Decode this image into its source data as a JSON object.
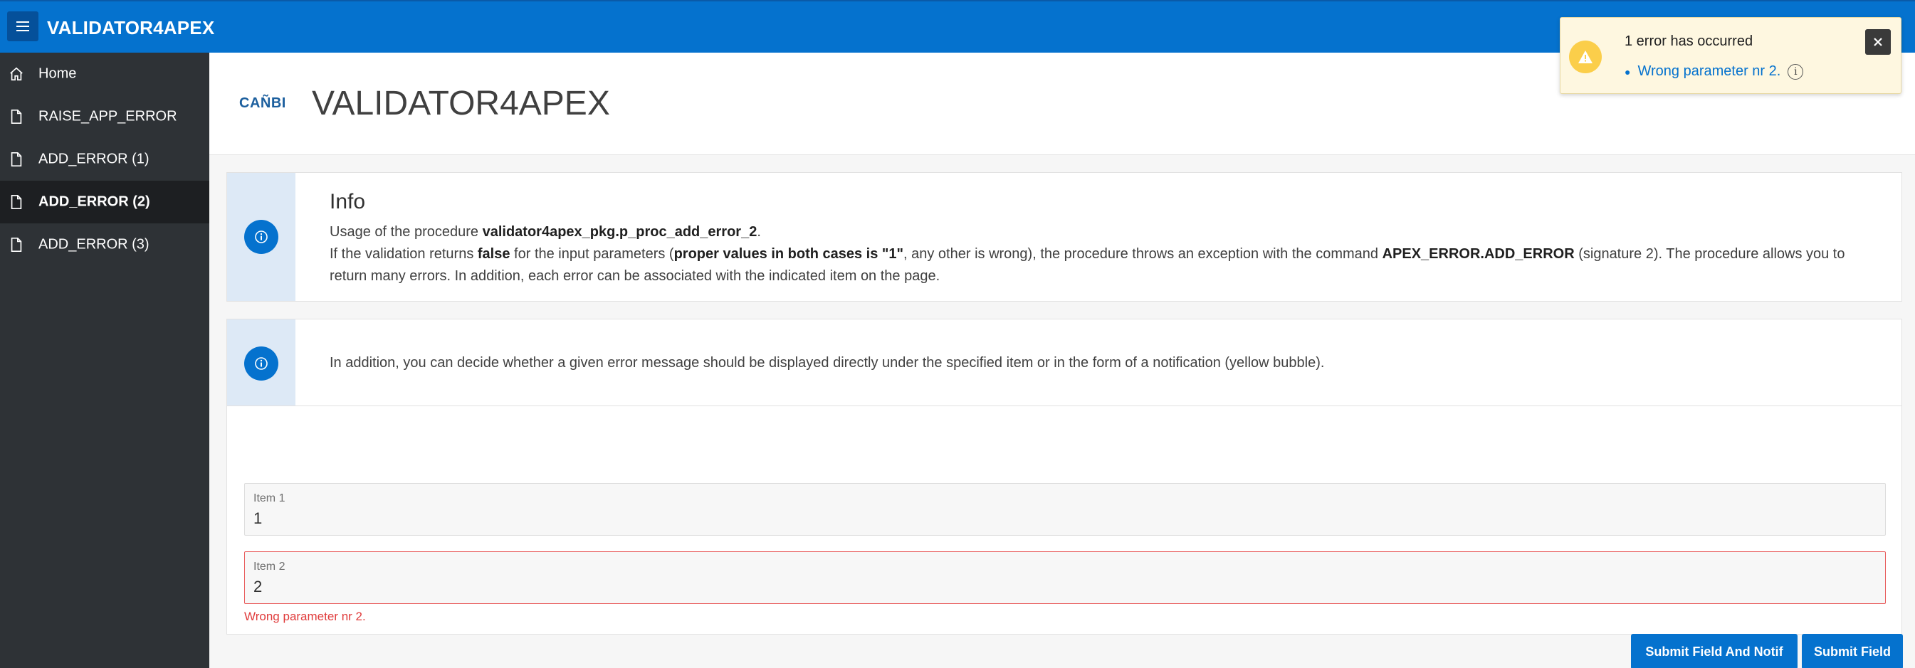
{
  "app": {
    "title": "VALIDATOR4APEX"
  },
  "sidebar": {
    "items": [
      {
        "label": "Home",
        "icon": "home-icon",
        "active": false
      },
      {
        "label": "RAISE_APP_ERROR",
        "icon": "file-icon",
        "active": false
      },
      {
        "label": "ADD_ERROR (1)",
        "icon": "file-icon",
        "active": false
      },
      {
        "label": "ADD_ERROR (2)",
        "icon": "file-icon",
        "active": true
      },
      {
        "label": "ADD_ERROR (3)",
        "icon": "file-icon",
        "active": false
      }
    ]
  },
  "page": {
    "logo": "CAÑBI",
    "title": "VALIDATOR4APEX"
  },
  "info": {
    "title": "Info",
    "line1_pre": "Usage of the procedure ",
    "line1_bold": "validator4apex_pkg.p_proc_add_error_2",
    "line1_post": ".",
    "line2_a": "If the validation returns ",
    "line2_b": "false",
    "line2_c": " for the input parameters (",
    "line2_d": "proper values in both cases is \"1\"",
    "line2_e": ", any other is wrong), the procedure throws an exception with the command ",
    "line2_f": "APEX_ERROR.ADD_ERROR",
    "line2_g": " (signature 2). The procedure allows you to return many errors. In addition, each error can be associated with the indicated item on the page."
  },
  "info2": {
    "text": "In addition, you can decide whether a given error message should be displayed directly under the specified item or in the form of a notification (yellow bubble)."
  },
  "form": {
    "item1": {
      "label": "Item 1",
      "value": "1"
    },
    "item2": {
      "label": "Item 2",
      "value": "2",
      "error": "Wrong parameter nr 2."
    },
    "submit_notif_label": "Submit Field And Notif",
    "submit_field_label": "Submit Field"
  },
  "notification": {
    "title": "1 error has occurred",
    "message": "Wrong parameter nr 2."
  },
  "colors": {
    "header": "#0572ce",
    "sidebar": "#2e3236",
    "error": "#e03b3b",
    "notification_bg": "#fef7e0",
    "warning": "#fbce4a"
  }
}
